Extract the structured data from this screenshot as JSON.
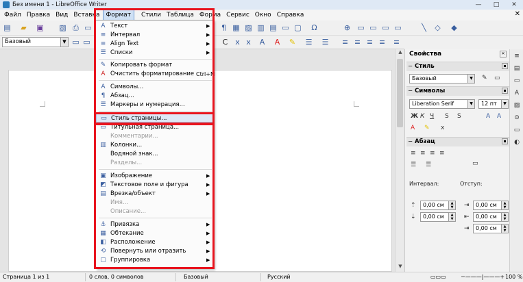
{
  "window": {
    "title": "Без имени 1 - LibreOffice Writer",
    "controls": [
      "—",
      "□",
      "✕"
    ]
  },
  "menubar": [
    {
      "label": "Файл"
    },
    {
      "label": "Правка"
    },
    {
      "label": "Вид"
    },
    {
      "label": "Вставка"
    },
    {
      "label": "Формат"
    },
    {
      "label": "Стили"
    },
    {
      "label": "Таблица"
    },
    {
      "label": "Форма"
    },
    {
      "label": "Сервис"
    },
    {
      "label": "Окно"
    },
    {
      "label": "Справка"
    }
  ],
  "toolbar": {
    "paragraph_style": "Базовый"
  },
  "format_menu": {
    "items": [
      {
        "label": "Текст",
        "icon": "A",
        "submenu": true
      },
      {
        "label": "Интервал",
        "icon": "≡",
        "submenu": true
      },
      {
        "label": "Align Text",
        "icon": "≡",
        "submenu": true
      },
      {
        "label": "Списки",
        "icon": "☰",
        "submenu": true
      },
      {
        "label": "Копировать формат",
        "icon": "✎"
      },
      {
        "label": "Очистить форматирование",
        "icon": "A",
        "shortcut": "Ctrl+M"
      },
      {
        "label": "Символы...",
        "icon": "A"
      },
      {
        "label": "Абзац...",
        "icon": "¶"
      },
      {
        "label": "Маркеры и нумерация...",
        "icon": "☰"
      },
      {
        "label": "Стиль страницы...",
        "icon": "▭"
      },
      {
        "label": "Титульная страница...",
        "icon": "▭"
      },
      {
        "label": "Комментарии...",
        "disabled": true
      },
      {
        "label": "Колонки...",
        "icon": "▥"
      },
      {
        "label": "Водяной знак...",
        "icon": ""
      },
      {
        "label": "Разделы...",
        "disabled": true
      },
      {
        "label": "Изображение",
        "icon": "▣",
        "submenu": true
      },
      {
        "label": "Текстовое поле и фигура",
        "icon": "◩",
        "submenu": true
      },
      {
        "label": "Врезка/объект",
        "icon": "▤",
        "submenu": true
      },
      {
        "label": "Имя...",
        "disabled": true
      },
      {
        "label": "Описание...",
        "disabled": true
      },
      {
        "label": "Привязка",
        "icon": "⚓",
        "submenu": true
      },
      {
        "label": "Обтекание",
        "icon": "▦",
        "submenu": true
      },
      {
        "label": "Расположение",
        "icon": "◧",
        "submenu": true
      },
      {
        "label": "Повернуть или отразить",
        "icon": "⟲",
        "submenu": true
      },
      {
        "label": "Группировка",
        "icon": "▢",
        "submenu": true
      }
    ]
  },
  "sidebar": {
    "title": "Свойства",
    "style_section": "Стиль",
    "style_value": "Базовый",
    "chars_section": "Символы",
    "font_name": "Liberation Serif",
    "font_size": "12 пт",
    "para_section": "Абзац",
    "spacing_label": "Интервал:",
    "indent_label": "Отступ:",
    "spin_value": "0,00 см"
  },
  "statusbar": {
    "page": "Страница 1 из 1",
    "words": "0 слов, 0 символов",
    "style": "Базовый",
    "language": "Русский",
    "zoom": "100 %"
  }
}
